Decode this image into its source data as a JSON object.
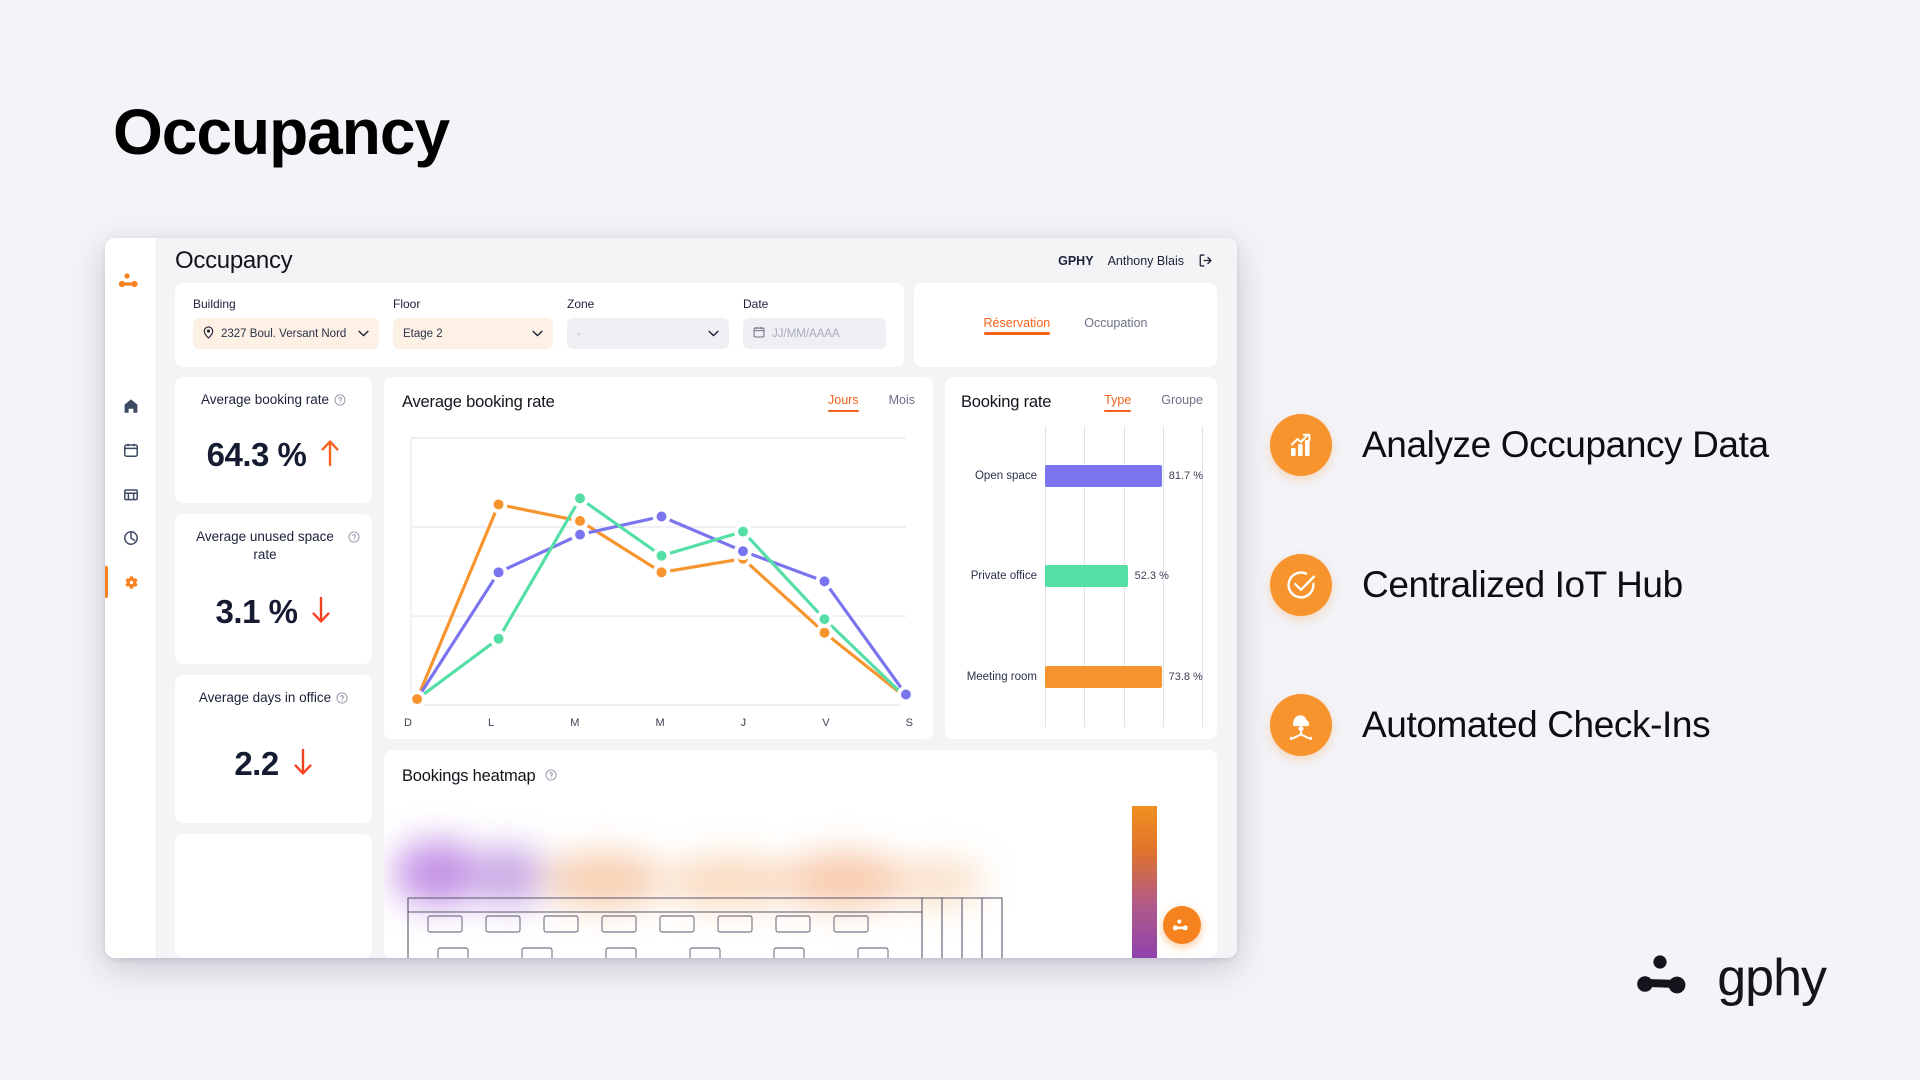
{
  "page": {
    "title": "Occupancy"
  },
  "app": {
    "header": {
      "title": "Occupancy",
      "org": "GPHY",
      "user": "Anthony Blais",
      "logout_icon": "logout-icon",
      "brand_icon": "gphy-logo-icon"
    },
    "sidebar": {
      "items": [
        {
          "icon": "home-icon",
          "active": false
        },
        {
          "icon": "calendar-icon",
          "active": false
        },
        {
          "icon": "building-icon",
          "active": false
        },
        {
          "icon": "pie-chart-icon",
          "active": false
        },
        {
          "icon": "gear-icon",
          "active": true
        }
      ]
    },
    "filters": {
      "building": {
        "label": "Building",
        "value": "2327 Boul. Versant Nord",
        "icon": "map-pin-icon",
        "chevron": "chevron-down-icon"
      },
      "floor": {
        "label": "Floor",
        "value": "Étage 2",
        "chevron": "chevron-down-icon"
      },
      "zone": {
        "label": "Zone",
        "value": "-",
        "chevron": "chevron-down-icon"
      },
      "date": {
        "label": "Date",
        "value": "",
        "placeholder": "JJ/MM/AAAA",
        "icon": "calendar-icon"
      }
    },
    "view_toggle": {
      "tabs": [
        {
          "label": "Réservation",
          "active": true
        },
        {
          "label": "Occupation",
          "active": false
        }
      ]
    },
    "kpis": [
      {
        "title": "Average booking rate",
        "value": "64.3 %",
        "trend": "up",
        "trend_color": "#f5621f",
        "info_icon": "info-icon"
      },
      {
        "title": "Average unused space rate",
        "value": "3.1 %",
        "trend": "down",
        "trend_color": "#f5421f",
        "info_icon": "info-icon"
      },
      {
        "title": "Average days in office",
        "value": "2.2",
        "trend": "down",
        "trend_color": "#f5421f",
        "info_icon": "info-icon"
      }
    ],
    "line_card": {
      "title": "Average booking rate",
      "tabs": [
        {
          "label": "Jours",
          "active": true
        },
        {
          "label": "Mois",
          "active": false
        }
      ]
    },
    "bar_card": {
      "title": "Booking rate",
      "tabs": [
        {
          "label": "Type",
          "active": true
        },
        {
          "label": "Groupe",
          "active": false
        }
      ]
    },
    "heatmap_card": {
      "title": "Bookings heatmap",
      "info_icon": "info-icon",
      "fab_icon": "gphy-mark-icon"
    }
  },
  "features": [
    {
      "icon": "bar-chart-growth-icon",
      "label": "Analyze Occupancy Data"
    },
    {
      "icon": "check-circle-icon",
      "label": "Centralized IoT Hub"
    },
    {
      "icon": "desk-person-icon",
      "label": "Automated Check-Ins"
    }
  ],
  "brand": {
    "name": "gphy",
    "mark_icon": "gphy-dots-icon"
  },
  "colors": {
    "accent_orange": "#f5821f",
    "accent_orange_dark": "#f5621f",
    "series_orange": "#f7942d",
    "series_purple": "#7b74ef",
    "series_green": "#55dfa6",
    "text_dark": "#151c32"
  },
  "chart_data": [
    {
      "type": "line",
      "title": "Average booking rate",
      "xlabel": "",
      "ylabel": "",
      "x": [
        "D",
        "L",
        "M",
        "M",
        "J",
        "V",
        "S"
      ],
      "ylim": [
        0,
        100
      ],
      "grid": true,
      "legend": "none",
      "series": [
        {
          "name": "series-orange",
          "color": "#f7942d",
          "values": [
            2,
            72,
            66,
            45,
            50,
            28,
            3
          ]
        },
        {
          "name": "series-purple",
          "color": "#7b74ef",
          "values": [
            2,
            47,
            62,
            69,
            58,
            48,
            4
          ]
        },
        {
          "name": "series-green",
          "color": "#55dfa6",
          "values": [
            2,
            22,
            73,
            52,
            63,
            33,
            3
          ]
        }
      ]
    },
    {
      "type": "bar",
      "orientation": "horizontal",
      "title": "Booking rate",
      "categories": [
        "Open space",
        "Private office",
        "Meeting room"
      ],
      "values": [
        81.7,
        52.3,
        73.8
      ],
      "value_labels": [
        "81.7 %",
        "52.3 %",
        "73.8 %"
      ],
      "colors": [
        "#7b74ef",
        "#55dfa6",
        "#f7942d"
      ],
      "xlim": [
        0,
        100
      ],
      "grid": true,
      "legend": "none"
    },
    {
      "type": "heatmap",
      "title": "Bookings heatmap",
      "legend": "vertical-gradient",
      "legend_colors": [
        "#f09020",
        "#8a3fb0"
      ]
    }
  ]
}
